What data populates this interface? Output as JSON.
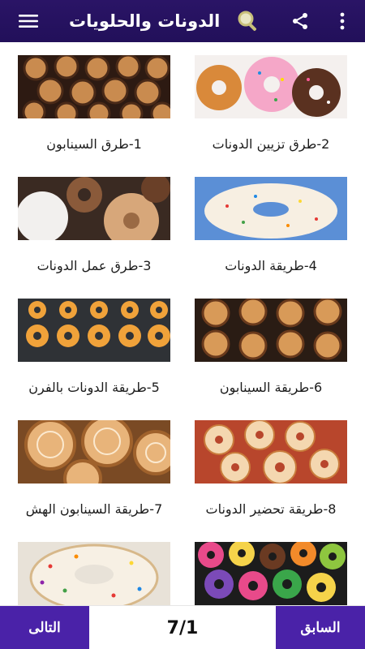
{
  "appbar": {
    "title": "الدونات والحلويات",
    "icons": [
      "menu-icon",
      "search-icon",
      "share-icon",
      "more-vert-icon"
    ]
  },
  "items": [
    {
      "caption": "2-طرق تزيين الدونات",
      "image": "decorated-donuts"
    },
    {
      "caption": "1-طرق السينابون",
      "image": "cinnamon-rolls-tray"
    },
    {
      "caption": "4-طريقة الدونات",
      "image": "sprinkle-donut"
    },
    {
      "caption": "3-طرق عمل الدونات",
      "image": "assorted-donuts"
    },
    {
      "caption": "6-طريقة السينابون",
      "image": "cinnamon-rolls-pan"
    },
    {
      "caption": "5-طريقة الدونات بالفرن",
      "image": "baked-donuts-pan"
    },
    {
      "caption": "8-طريقة تحضير الدونات",
      "image": "glazed-donuts-plate"
    },
    {
      "caption": "7-طريقة السينابون الهش",
      "image": "cinnamon-rolls-glazed"
    },
    {
      "caption": "",
      "image": "colorful-donuts-box"
    },
    {
      "caption": "",
      "image": "sprinkle-donut-closeup"
    }
  ],
  "bottom": {
    "next_label": "التالى",
    "prev_label": "السابق",
    "page_indicator": "7/1"
  },
  "colors": {
    "appbar": "#22105a",
    "button": "#4a22a8",
    "search_icon": "#d8d19a"
  }
}
